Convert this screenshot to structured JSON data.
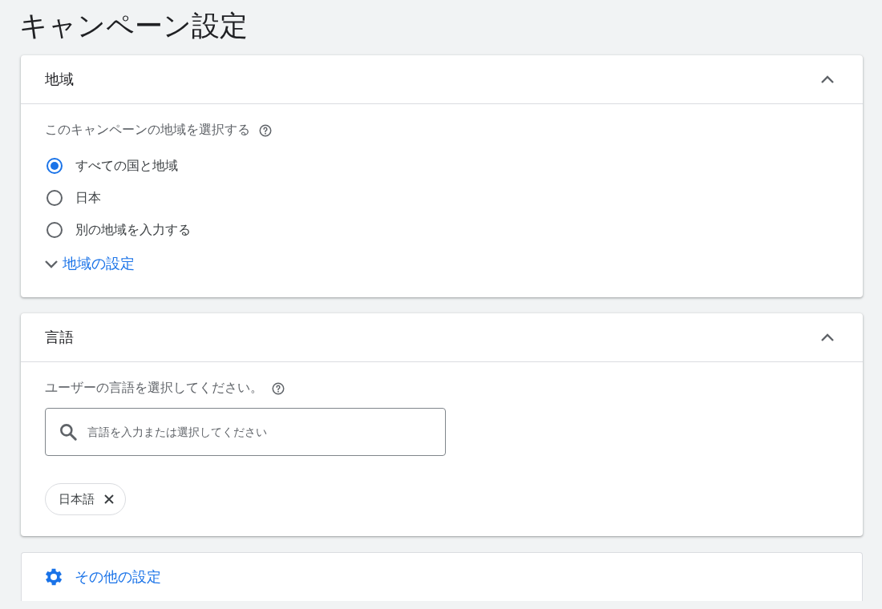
{
  "page_title": "キャンペーン設定",
  "location_panel": {
    "title": "地域",
    "expanded": true,
    "question": "このキャンペーンの地域を選択する",
    "options": [
      {
        "label": "すべての国と地域",
        "selected": true
      },
      {
        "label": "日本",
        "selected": false
      },
      {
        "label": "別の地域を入力する",
        "selected": false
      }
    ],
    "settings_link": "地域の設定"
  },
  "language_panel": {
    "title": "言語",
    "expanded": true,
    "question": "ユーザーの言語を選択してください。",
    "search": {
      "placeholder": "言語を入力または選択してください"
    },
    "chips": [
      {
        "label": "日本語"
      }
    ]
  },
  "other_settings": {
    "label": "その他の設定"
  }
}
